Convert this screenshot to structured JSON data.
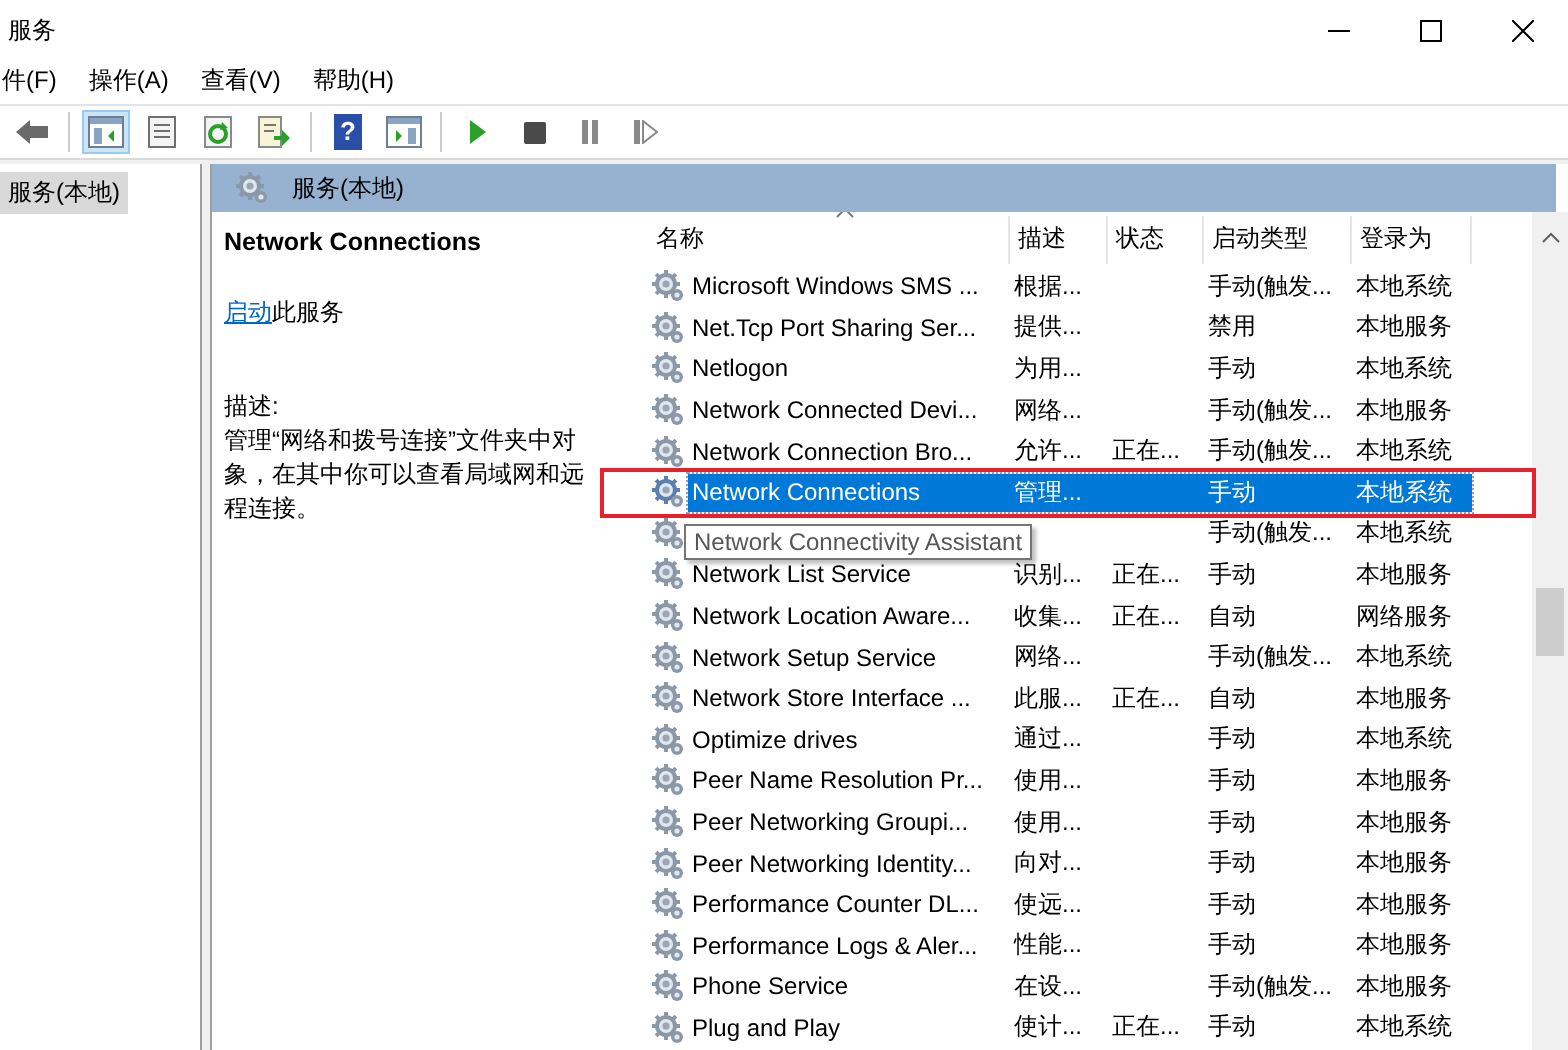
{
  "window": {
    "title": "服务"
  },
  "menu": [
    "件(F)",
    "操作(A)",
    "查看(V)",
    "帮助(H)"
  ],
  "toolbar": [
    {
      "kind": "back",
      "selected": false
    },
    {
      "kind": "tree",
      "selected": true
    },
    {
      "kind": "props",
      "selected": false
    },
    {
      "kind": "refresh",
      "selected": false
    },
    {
      "kind": "export",
      "selected": false
    },
    {
      "kind": "help",
      "selected": false,
      "glyph": "?"
    },
    {
      "kind": "view",
      "selected": false
    },
    {
      "kind": "play",
      "selected": false
    },
    {
      "kind": "stop",
      "selected": false
    },
    {
      "kind": "pause",
      "selected": false
    },
    {
      "kind": "resume",
      "selected": false
    }
  ],
  "tree": {
    "items": [
      {
        "label": "服务(本地)",
        "selected": true
      }
    ]
  },
  "pane_header": "服务(本地)",
  "detail": {
    "title": "Network Connections",
    "action_link": "启动",
    "action_text": "此服务",
    "description_label": "描述:",
    "description": "管理“网络和拨号连接”文件夹中对象，在其中你可以查看局域网和远程连接。"
  },
  "table": {
    "columns": [
      "名称",
      "描述",
      "状态",
      "启动类型",
      "登录为"
    ],
    "rows": [
      {
        "name": "Microsoft Windows SMS ...",
        "description": "根据...",
        "start_type": "手动(触发...",
        "logon": "本地系统",
        "selected": false
      },
      {
        "name": "Net.Tcp Port Sharing Ser...",
        "description": "提供...",
        "start_type": "禁用",
        "logon": "本地服务",
        "selected": false
      },
      {
        "name": "Netlogon",
        "description": "为用...",
        "start_type": "手动",
        "logon": "本地系统",
        "selected": false
      },
      {
        "name": "Network Connected Devi...",
        "description": "网络...",
        "start_type": "手动(触发...",
        "logon": "本地服务",
        "selected": false
      },
      {
        "name": "Network Connection Bro...",
        "description": "允许...",
        "status": "正在...",
        "start_type": "手动(触发...",
        "logon": "本地系统",
        "selected": false
      },
      {
        "name": "Network Connections",
        "description": "管理...",
        "start_type": "手动",
        "logon": "本地系统",
        "selected": true
      },
      {
        "tooltip": "Network Connectivity Assistant",
        "start_type": "手动(触发...",
        "logon": "本地系统",
        "selected": false
      },
      {
        "name": "Network List Service",
        "description": "识别...",
        "status": "正在...",
        "start_type": "手动",
        "logon": "本地服务",
        "selected": false
      },
      {
        "name": "Network Location Aware...",
        "description": "收集...",
        "status": "正在...",
        "start_type": "自动",
        "logon": "网络服务",
        "selected": false
      },
      {
        "name": "Network Setup Service",
        "description": "网络...",
        "start_type": "手动(触发...",
        "logon": "本地系统",
        "selected": false
      },
      {
        "name": "Network Store Interface ...",
        "description": "此服...",
        "status": "正在...",
        "start_type": "自动",
        "logon": "本地服务",
        "selected": false
      },
      {
        "name": "Optimize drives",
        "description": "通过...",
        "start_type": "手动",
        "logon": "本地系统",
        "selected": false
      },
      {
        "name": "Peer Name Resolution Pr...",
        "description": "使用...",
        "start_type": "手动",
        "logon": "本地服务",
        "selected": false
      },
      {
        "name": "Peer Networking Groupi...",
        "description": "使用...",
        "start_type": "手动",
        "logon": "本地服务",
        "selected": false
      },
      {
        "name": "Peer Networking Identity...",
        "description": "向对...",
        "start_type": "手动",
        "logon": "本地服务",
        "selected": false
      },
      {
        "name": "Performance Counter DL...",
        "description": "使远...",
        "start_type": "手动",
        "logon": "本地服务",
        "selected": false
      },
      {
        "name": "Performance Logs & Aler...",
        "description": "性能...",
        "start_type": "手动",
        "logon": "本地服务",
        "selected": false
      },
      {
        "name": "Phone Service",
        "description": "在设...",
        "start_type": "手动(触发...",
        "logon": "本地服务",
        "selected": false
      },
      {
        "name": "Plug and Play",
        "description": "使计...",
        "status": "正在...",
        "start_type": "手动",
        "logon": "本地系统",
        "selected": false
      }
    ]
  }
}
